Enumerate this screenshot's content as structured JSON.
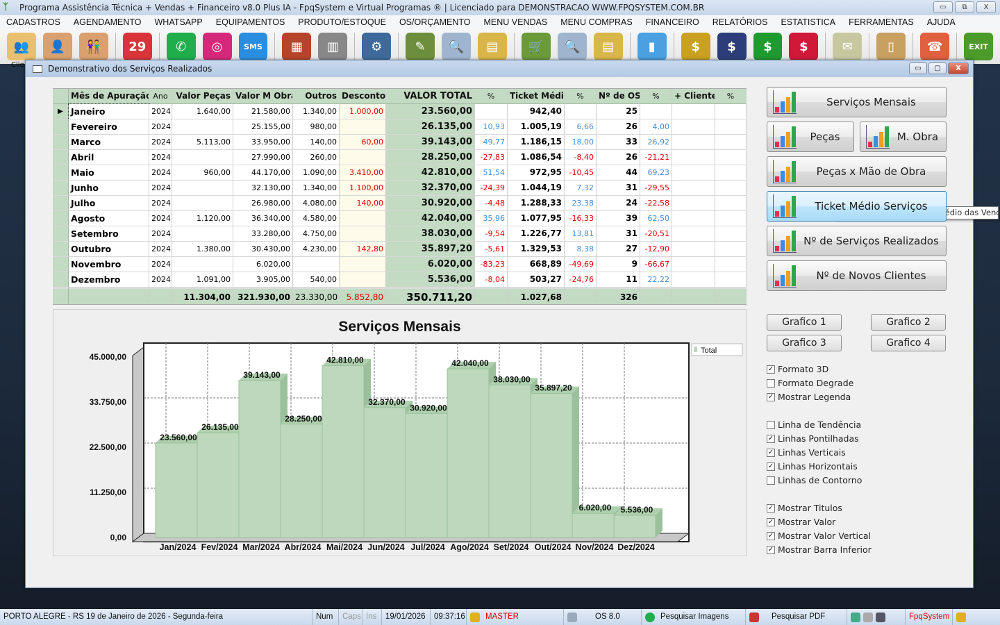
{
  "app": {
    "title": "Programa Assistência Técnica + Vendas + Financeiro v8.0 Plus IA - FpqSystem e Virtual Programas ® | Licenciado para  DEMONSTRACAO WWW.FPQSYSTEM.COM.BR",
    "window_controls": {
      "minimize": "▭",
      "restore": "⧉",
      "close": "X"
    }
  },
  "menu": [
    "CADASTROS",
    "AGENDAMENTO",
    "WHATSAPP",
    "EQUIPAMENTOS",
    "PRODUTO/ESTOQUE",
    "OS/ORÇAMENTO",
    "MENU VENDAS",
    "MENU COMPRAS",
    "FINANCEIRO",
    "RELATÓRIOS",
    "ESTATISTICA",
    "FERRAMENTAS",
    "AJUDA"
  ],
  "toolbar": {
    "icons": [
      {
        "name": "clients-icon",
        "glyph": "👥",
        "color": "#e8c070"
      },
      {
        "name": "user-icon",
        "glyph": "👤",
        "color": "#d9a070"
      },
      {
        "name": "users-couple-icon",
        "glyph": "👫",
        "color": "#d9a070"
      },
      {
        "name": "calendar-icon",
        "glyph": "29",
        "color": "#d9343a"
      },
      {
        "name": "whatsapp-icon",
        "glyph": "✆",
        "color": "#1fae4b"
      },
      {
        "name": "instagram-icon",
        "glyph": "◎",
        "color": "#d6287a"
      },
      {
        "name": "sms-icon",
        "glyph": "SMS",
        "color": "#2b8de0"
      },
      {
        "name": "products-icon",
        "glyph": "▦",
        "color": "#b5442a"
      },
      {
        "name": "barcode-icon",
        "glyph": "▥",
        "color": "#888888"
      },
      {
        "name": "equipment-icon",
        "glyph": "⚙",
        "color": "#3d6a9a"
      },
      {
        "name": "clipboard-icon",
        "glyph": "✎",
        "color": "#6d8f3d"
      },
      {
        "name": "search-document-icon",
        "glyph": "🔍",
        "color": "#9fb5cf"
      },
      {
        "name": "cash-register-icon",
        "glyph": "▤",
        "color": "#d9b64a"
      },
      {
        "name": "shopping-cart-icon",
        "glyph": "🛒",
        "color": "#6a9a3a"
      },
      {
        "name": "search-purchase-icon",
        "glyph": "🔍",
        "color": "#9fb5cf"
      },
      {
        "name": "cash-register-2-icon",
        "glyph": "▤",
        "color": "#d9b64a"
      },
      {
        "name": "statistics-chart-icon",
        "glyph": "▮",
        "color": "#4aa0e0"
      },
      {
        "name": "finance-pie-icon",
        "glyph": "$",
        "color": "#c9a020"
      },
      {
        "name": "ledger-icon",
        "glyph": "$",
        "color": "#2c3e7a"
      },
      {
        "name": "money-green-icon",
        "glyph": "$",
        "color": "#1f9a2f"
      },
      {
        "name": "money-red-icon",
        "glyph": "$",
        "color": "#d01838"
      },
      {
        "name": "receipt-icon",
        "glyph": "✉",
        "color": "#c8c8a0"
      },
      {
        "name": "scroll-icon",
        "glyph": "▯",
        "color": "#c8a060"
      },
      {
        "name": "support-icon",
        "glyph": "☎",
        "color": "#e06040"
      },
      {
        "name": "exit-door-icon",
        "glyph": "EXIT",
        "color": "#4c9a2a"
      }
    ],
    "partial_label": "Clie"
  },
  "window": {
    "title": "Demonstrativo dos Serviços Realizados"
  },
  "table": {
    "headers": [
      "Mês de Apuração",
      "Ano",
      "Valor Peças",
      "Valor M Obra",
      "Outros",
      "Desconto",
      "VALOR TOTAL",
      "%",
      "Ticket Médio",
      "%",
      "Nº de OS",
      "%",
      "+ Clientes",
      "%"
    ],
    "rows": [
      [
        "Janeiro",
        "2024",
        "1.640,00",
        "21.580,00",
        "1.340,00",
        "1.000,00",
        "23.560,00",
        "",
        "942,40",
        "",
        "25",
        "",
        "",
        ""
      ],
      [
        "Fevereiro",
        "2024",
        "",
        "25.155,00",
        "980,00",
        "",
        "26.135,00",
        "10,93",
        "1.005,19",
        "6,66",
        "26",
        "4,00",
        "",
        ""
      ],
      [
        "Marco",
        "2024",
        "5.113,00",
        "33.950,00",
        "140,00",
        "60,00",
        "39.143,00",
        "49,77",
        "1.186,15",
        "18,00",
        "33",
        "26,92",
        "",
        ""
      ],
      [
        "Abril",
        "2024",
        "",
        "27.990,00",
        "260,00",
        "",
        "28.250,00",
        "-27,83",
        "1.086,54",
        "-8,40",
        "26",
        "-21,21",
        "",
        ""
      ],
      [
        "Maio",
        "2024",
        "960,00",
        "44.170,00",
        "1.090,00",
        "3.410,00",
        "42.810,00",
        "51,54",
        "972,95",
        "-10,45",
        "44",
        "69,23",
        "",
        ""
      ],
      [
        "Junho",
        "2024",
        "",
        "32.130,00",
        "1.340,00",
        "1.100,00",
        "32.370,00",
        "-24,39",
        "1.044,19",
        "7,32",
        "31",
        "-29,55",
        "",
        ""
      ],
      [
        "Julho",
        "2024",
        "",
        "26.980,00",
        "4.080,00",
        "140,00",
        "30.920,00",
        "-4,48",
        "1.288,33",
        "23,38",
        "24",
        "-22,58",
        "",
        ""
      ],
      [
        "Agosto",
        "2024",
        "1.120,00",
        "36.340,00",
        "4.580,00",
        "",
        "42.040,00",
        "35,96",
        "1.077,95",
        "-16,33",
        "39",
        "62,50",
        "",
        ""
      ],
      [
        "Setembro",
        "2024",
        "",
        "33.280,00",
        "4.750,00",
        "",
        "38.030,00",
        "-9,54",
        "1.226,77",
        "13,81",
        "31",
        "-20,51",
        "",
        ""
      ],
      [
        "Outubro",
        "2024",
        "1.380,00",
        "30.430,00",
        "4.230,00",
        "142,80",
        "35.897,20",
        "-5,61",
        "1.329,53",
        "8,38",
        "27",
        "-12,90",
        "",
        ""
      ],
      [
        "Novembro",
        "2024",
        "",
        "6.020,00",
        "",
        "",
        "6.020,00",
        "-83,23",
        "668,89",
        "-49,69",
        "9",
        "-66,67",
        "",
        ""
      ],
      [
        "Dezembro",
        "2024",
        "1.091,00",
        "3.905,00",
        "540,00",
        "",
        "5.536,00",
        "-8,04",
        "503,27",
        "-24,76",
        "11",
        "22,22",
        "",
        ""
      ]
    ],
    "totals": [
      "",
      "",
      "11.304,00",
      "321.930,00",
      "23.330,00",
      "5.852,80",
      "350.711,20",
      "",
      "1.027,68",
      "",
      "326",
      "",
      "",
      ""
    ],
    "selected_row": 0,
    "colors": {
      "header_bg": "#c3dac3",
      "negative": "#e00000",
      "positive": "#3d8fe0",
      "discount": "#e00000"
    }
  },
  "chart_data": {
    "type": "bar",
    "title": "Serviços Mensais",
    "categories": [
      "Jan/2024",
      "Fev/2024",
      "Mar/2024",
      "Abr/2024",
      "Mai/2024",
      "Jun/2024",
      "Jul/2024",
      "Ago/2024",
      "Set/2024",
      "Out/2024",
      "Nov/2024",
      "Dez/2024"
    ],
    "series": [
      {
        "name": "Total",
        "values": [
          23560,
          26135,
          39143,
          28250,
          42810,
          32370,
          30920,
          42040,
          38030,
          35897.2,
          6020,
          5536
        ]
      }
    ],
    "value_labels": [
      "23.560,00",
      "26.135,00",
      "39.143,00",
      "28.250,00",
      "42.810,00",
      "32.370,00",
      "30.920,00",
      "42.040,00",
      "38.030,00",
      "35.897,20",
      "6.020,00",
      "5.536,00"
    ],
    "ylim": [
      0,
      45000
    ],
    "yticks": [
      0,
      11250,
      22500,
      33750,
      45000
    ],
    "ytick_labels": [
      "0,00",
      "11.250,00",
      "22.500,00",
      "33.750,00",
      "45.000,00"
    ],
    "legend": "top-right",
    "grid": true,
    "style": "3d",
    "bar_color": "#bed8be"
  },
  "right_panel": {
    "buttons": [
      "Serviços Mensais",
      "Peças",
      "M. Obra",
      "Peças x Mão de Obra",
      "Ticket Médio Serviços",
      "Nº de Serviços Realizados",
      "Nº de Novos Clientes"
    ],
    "tooltip": "Gerar Gráfico dos Ticket Médio das Vendas",
    "graph_buttons": [
      "Grafico 1",
      "Grafico 2",
      "Grafico 3",
      "Grafico 4"
    ],
    "options": [
      {
        "label": "Formato 3D",
        "checked": true
      },
      {
        "label": "Formato Degrade",
        "checked": false
      },
      {
        "label": "Mostrar Legenda",
        "checked": true
      },
      {
        "label": "Linha de Tendência",
        "checked": false
      },
      {
        "label": "Linhas Pontilhadas",
        "checked": true
      },
      {
        "label": "Linhas Verticais",
        "checked": true
      },
      {
        "label": "Linhas Horizontais",
        "checked": true
      },
      {
        "label": "Linhas de Contorno",
        "checked": false
      },
      {
        "label": "Mostrar Titulos",
        "checked": true
      },
      {
        "label": "Mostrar Valor",
        "checked": true
      },
      {
        "label": "Mostrar Valor Vertical",
        "checked": true
      },
      {
        "label": "Mostrar Barra Inferior",
        "checked": true
      }
    ]
  },
  "status": {
    "location": "PORTO ALEGRE - RS 19 de Janeiro de 2026 - Segunda-feira",
    "num": "Num",
    "caps": "Caps",
    "ins": "Ins",
    "date": "19/01/2026",
    "time": "09:37:16",
    "user": "MASTER",
    "version": "OS 8.0",
    "search_images": "Pesquisar Imagens",
    "search_pdf": "Pesquisar PDF",
    "brand": "FpqSystem"
  }
}
